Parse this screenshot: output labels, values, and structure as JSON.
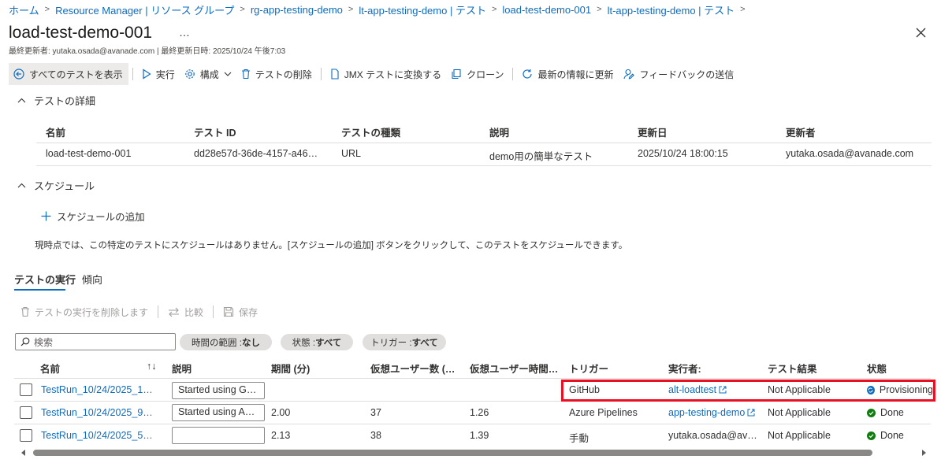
{
  "breadcrumb": [
    "ホーム",
    "Resource Manager | リソース グループ",
    "rg-app-testing-demo",
    "lt-app-testing-demo | テスト",
    "load-test-demo-001",
    "lt-app-testing-demo | テスト"
  ],
  "page": {
    "title": "load-test-demo-001",
    "more": "…",
    "subtitle": "最終更新者: yutaka.osada@avanade.com | 最終更新日時: 2025/10/24 午後7:03"
  },
  "toolbar": {
    "show_all": "すべてのテストを表示",
    "run": "実行",
    "configure": "構成",
    "delete": "テストの削除",
    "jmx": "JMX テストに変換する",
    "clone": "クローン",
    "refresh": "最新の情報に更新",
    "feedback": "フィードバックの送信"
  },
  "details": {
    "header": "テストの詳細",
    "columns": [
      "名前",
      "テスト ID",
      "テストの種類",
      "説明",
      "更新日",
      "更新者"
    ],
    "row": [
      "load-test-demo-001",
      "dd28e57d-36de-4157-a46…",
      "URL",
      "demo用の簡単なテスト",
      "2025/10/24 18:00:15",
      "yutaka.osada@avanade.com"
    ]
  },
  "schedule": {
    "header": "スケジュール",
    "add": "スケジュールの追加",
    "note": "現時点では、この特定のテストにスケジュールはありません。[スケジュールの追加] ボタンをクリックして、このテストをスケジュールできます。"
  },
  "tabs": [
    "テストの実行",
    "傾向"
  ],
  "runs_toolbar": {
    "delete": "テストの実行を削除します",
    "compare": "比較",
    "save": "保存"
  },
  "filters": {
    "search_placeholder": "検索",
    "time_range_label": "時間の範囲 : ",
    "time_range_value": "なし",
    "state_label": "状態 : ",
    "state_value": "すべて",
    "trigger_label": "トリガー : ",
    "trigger_value": "すべて"
  },
  "runs": {
    "columns": [
      "名前",
      "説明",
      "期間 (分)",
      "仮想ユーザー数 (…",
      "仮想ユーザー時間…",
      "トリガー",
      "実行者:",
      "テスト結果",
      "状態"
    ],
    "sort_indicator": "↑↓",
    "rows": [
      {
        "name": "TestRun_10/24/2025_1…",
        "desc": "Started using G…",
        "duration": "",
        "vusers": "",
        "vuhours": "",
        "trigger": "GitHub",
        "runner": "alt-loadtest",
        "runner_link": true,
        "result": "Not Applicable",
        "state": "Provisioning",
        "state_color": "#0f6cbd"
      },
      {
        "name": "TestRun_10/24/2025_9…",
        "desc": "Started using A…",
        "duration": "2.00",
        "vusers": "37",
        "vuhours": "1.26",
        "trigger": "Azure Pipelines",
        "runner": "app-testing-demo",
        "runner_link": true,
        "result": "Not Applicable",
        "state": "Done",
        "state_color": "#107c10"
      },
      {
        "name": "TestRun_10/24/2025_5…",
        "desc": "",
        "duration": "2.13",
        "vusers": "38",
        "vuhours": "1.39",
        "trigger": "手動",
        "runner": "yutaka.osada@av…",
        "runner_link": false,
        "result": "Not Applicable",
        "state": "Done",
        "state_color": "#107c10"
      }
    ]
  },
  "colors": {
    "accent": "#0f6cbd",
    "highlight": "#e81123",
    "success": "#107c10"
  }
}
